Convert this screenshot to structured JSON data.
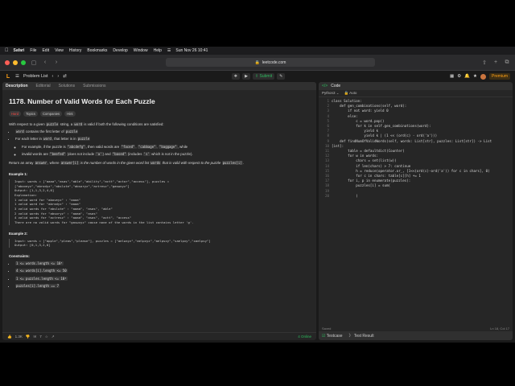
{
  "menubar": {
    "app": "Safari",
    "items": [
      "File",
      "Edit",
      "View",
      "History",
      "Bookmarks",
      "Develop",
      "Window",
      "Help"
    ],
    "datetime": "Sun Nov 26 10:41"
  },
  "browser": {
    "url": "leetcode.com"
  },
  "nav": {
    "problem_list": "Problem List",
    "submit": "Submit",
    "premium": "Premium"
  },
  "left_tabs": [
    "Description",
    "Editorial",
    "Solutions",
    "Submissions"
  ],
  "problem": {
    "title": "1178. Number of Valid Words for Each Puzzle",
    "difficulty": "Hard",
    "badges": [
      "Topics",
      "Companies",
      "Hint"
    ],
    "intro_a": "With respect to a given ",
    "intro_code": "puzzle",
    "intro_b": " string, a ",
    "intro_code2": "word",
    "intro_c": " is valid if both the following conditions are satisfied:",
    "cond1_code": "word",
    "cond1": " contains the first letter of ",
    "cond1_code2": "puzzle",
    "cond2_a": "For each letter in ",
    "cond2_code": "word",
    "cond2_b": ", that letter is in ",
    "cond2_code2": "puzzle",
    "sub1_a": "For example, if the puzzle is ",
    "sub1_code": "\"abcdefg\"",
    "sub1_b": ", then valid words are ",
    "sub1_c1": "\"faced\"",
    "sub1_c2": "\"cabbage\"",
    "sub1_c3": "\"baggage\"",
    "sub1_c": ", while",
    "sub2_a": "invalid words are ",
    "sub2_c1": "\"beefed\"",
    "sub2_b": " (does not include ",
    "sub2_c2": "'a'",
    "sub2_c": ") and ",
    "sub2_c3": "\"based\"",
    "sub2_d": " (includes ",
    "sub2_c4": "'s'",
    "sub2_e": " which is not in the puzzle).",
    "return_a": "Return an array ",
    "return_code": "answer",
    "return_b": ", where ",
    "return_code2": "answer[i]",
    "return_c": " is the number of words in the given word list ",
    "return_code3": "words",
    "return_d": " that is valid with respect to the puzzle ",
    "return_code4": "puzzles[i]",
    "ex1_title": "Example 1:",
    "ex1_body": "Input: words = [\"aaaa\",\"asas\",\"able\",\"ability\",\"actt\",\"actor\",\"access\"], puzzles =\n[\"aboveyz\",\"abrodyz\",\"abslute\",\"absoryz\",\"actresz\",\"gaswxyz\"]\nOutput: [1,1,3,2,4,0]\nExplanation:\n1 valid word for \"aboveyz\" : \"aaaa\"\n1 valid word for \"abrodyz\" : \"aaaa\"\n3 valid words for \"abslute\" : \"aaaa\", \"asas\", \"able\"\n2 valid words for \"absoryz\" : \"aaaa\", \"asas\"\n4 valid words for \"actresz\" : \"aaaa\", \"asas\", \"actt\", \"access\"\nThere are no valid words for \"gaswxyz\" cause none of the words in the list contains letter 'g'.",
    "ex2_title": "Example 2:",
    "ex2_body": "Input: words = [\"apple\",\"pleas\",\"please\"], puzzles = [\"aelwxyz\",\"aelpxyz\",\"aelpsxy\",\"saelpxy\",\"xaelpsy\"]\nOutput: [0,1,3,2,0]",
    "constraints_title": "Constraints:",
    "constraints": [
      "1 <= words.length <= 10⁵",
      "4 <= words[i].length <= 50",
      "1 <= puzzles.length <= 10⁴",
      "puzzles[i].length == 7"
    ]
  },
  "footer": {
    "likes": "1.3K",
    "comments": "7",
    "online": "4 Online"
  },
  "editor": {
    "header": "Code",
    "language": "Python3",
    "autosave": "Auto",
    "saved": "Saved",
    "cursor": "Ln 18, Col 17",
    "line_numbers": [
      "1",
      "2",
      "3",
      "4",
      "5",
      "6",
      "7",
      "8",
      "9",
      "10",
      "11",
      "12",
      "13",
      "14",
      "15",
      "16",
      "17",
      "18",
      "19",
      "20"
    ],
    "code": "class Solution:\n    def gen_combinations(self, word):\n        if not word: yield 0\n        else:\n            c = word.pop()\n            for k in self.gen_combinations(word):\n                yield k\n                yield k | (1 << (ord(c) - ord('a')))\n    def findNumOfValidWords(self, words: List[str], puzzles: List[str]) -> List\n[int]:\n        table = defaultdict(Counter)\n        for w in words:\n            chars = set(list(w))\n            if len(chars) > 7: continue\n            h = reduce(operator.or_, [1<<(ord(c)-ord('a')) for c in chars], 0)\n            for c in chars: table[c][h] += 1\n        for i, p in enumerate(puzzles):\n            puzzles[i] = sum(\n                \n            )\n"
  },
  "bottom_tabs": [
    "Testcase",
    "Test Result"
  ]
}
